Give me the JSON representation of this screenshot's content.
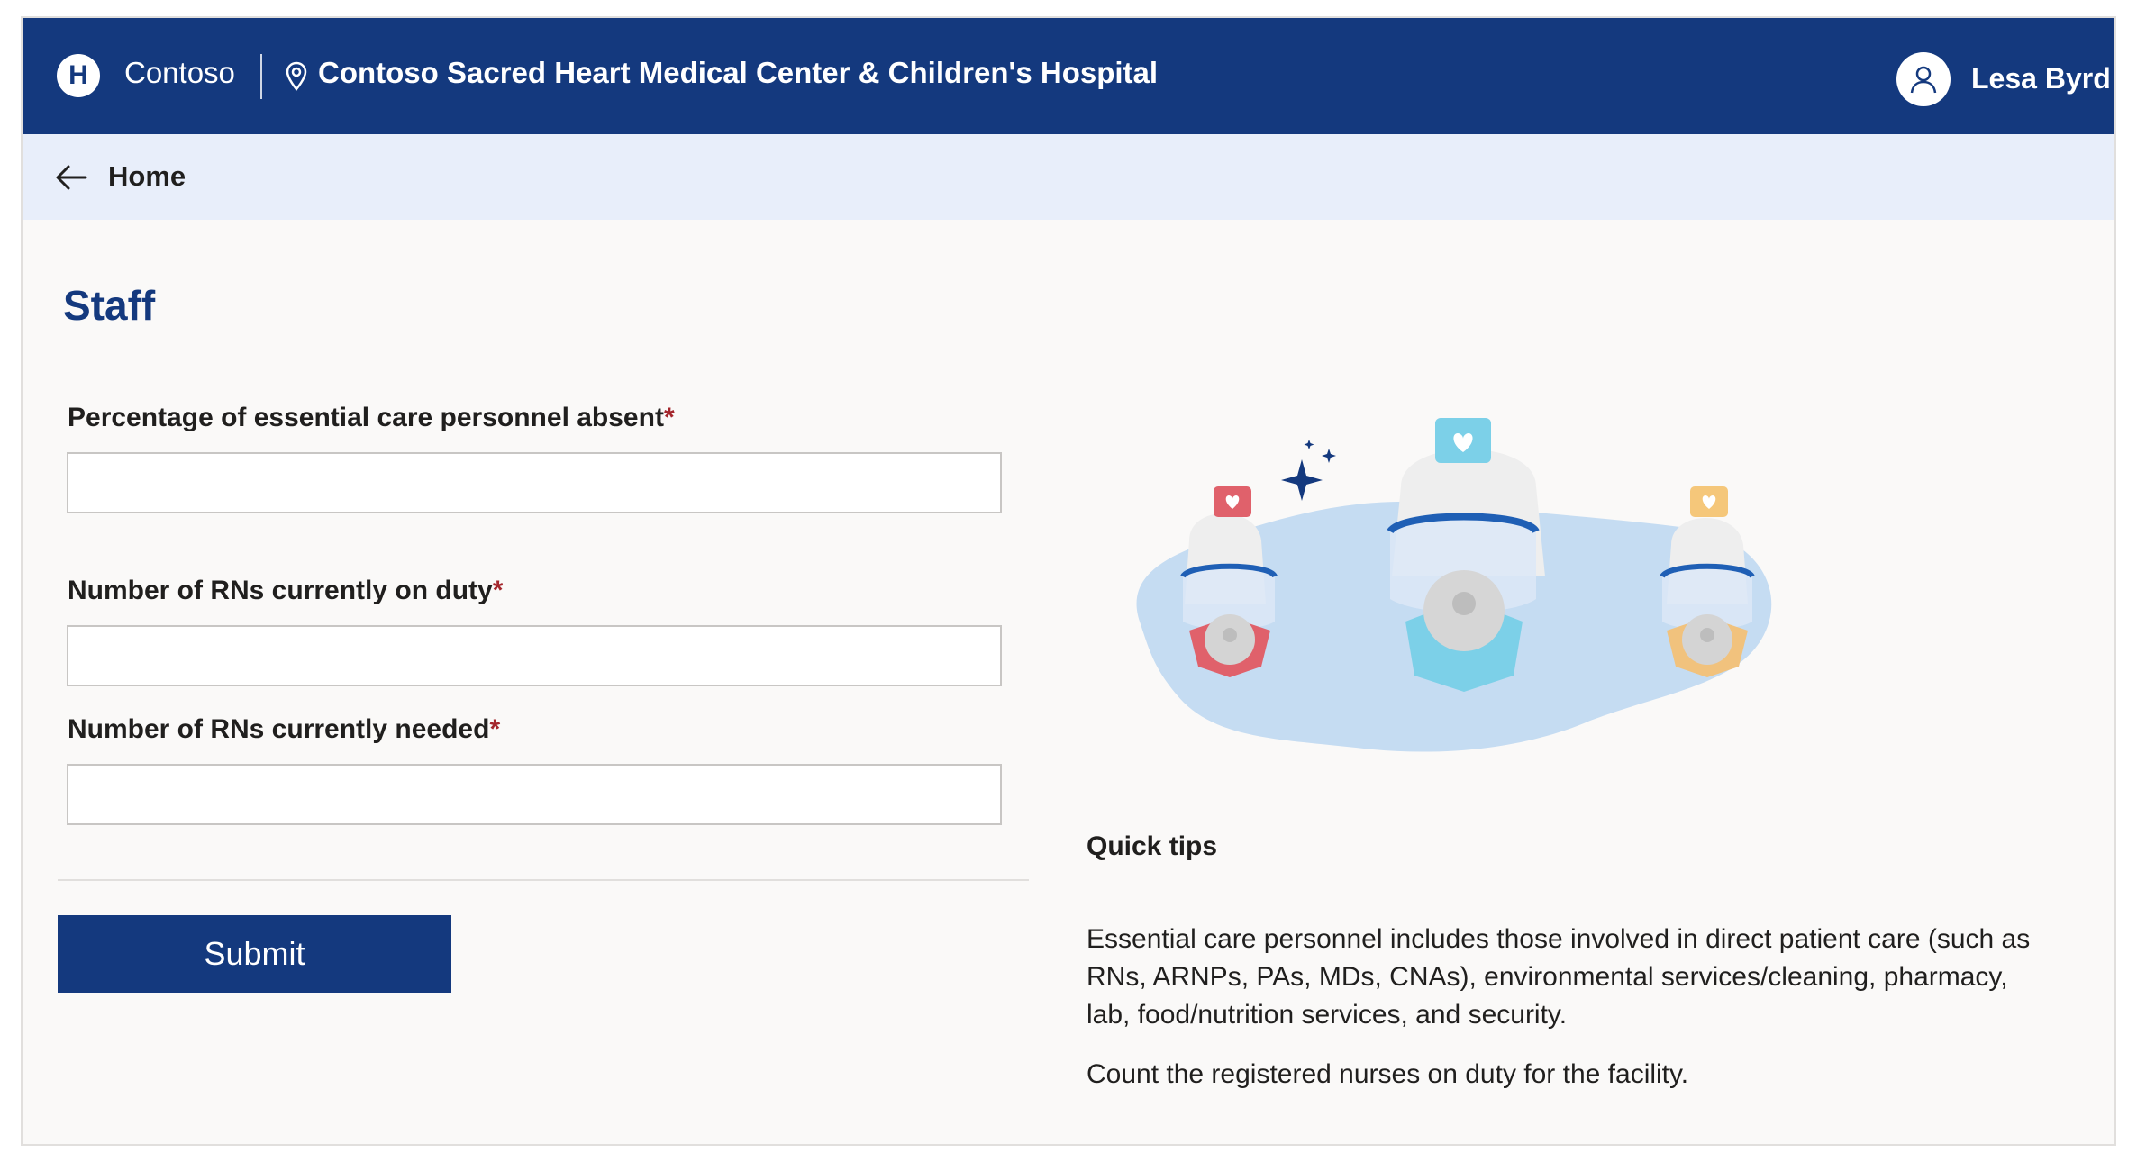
{
  "header": {
    "brand": "Contoso",
    "logo_letter": "H",
    "facility": "Contoso Sacred Heart Medical Center & Children's Hospital",
    "user_name": "Lesa Byrd",
    "background": "#14397e"
  },
  "breadcrumb": {
    "home_label": "Home",
    "back_icon": "arrow-left-icon"
  },
  "page": {
    "title": "Staff"
  },
  "form": {
    "fields": [
      {
        "label": "Percentage of essential care personnel absent",
        "required_mark": "*",
        "value": ""
      },
      {
        "label": "Number of RNs currently on duty",
        "required_mark": "*",
        "value": ""
      },
      {
        "label": "Number of RNs currently needed",
        "required_mark": "*",
        "value": ""
      }
    ],
    "submit_label": "Submit"
  },
  "tips": {
    "title": "Quick tips",
    "paragraphs": [
      "Essential care personnel includes those involved in direct patient care (such as RNs, ARNPs, PAs, MDs, CNAs), environmental services/cleaning, pharmacy, lab, food/nutrition services, and security.",
      "Count the registered nurses on duty for the facility."
    ]
  },
  "colors": {
    "primary": "#14397e",
    "breadcrumb_bg": "#e8eefa",
    "required": "#a4262c"
  }
}
